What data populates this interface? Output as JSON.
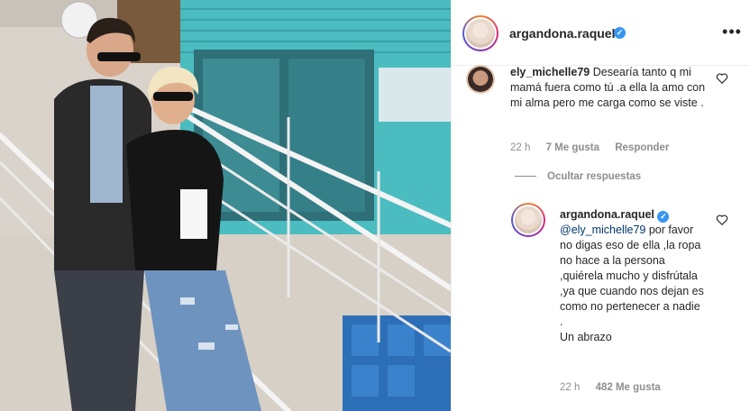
{
  "post": {
    "author": "argandona.raquel",
    "image_alt": "Pareja en escalera metálica frente a casa de madera turquesa"
  },
  "header": {
    "username": "argandona.raquel",
    "more_icon": "more-horizontal-icon"
  },
  "comments": [
    {
      "username": "ely_michelle79",
      "text": "Desearía tanto q mi mamá fuera como tú .a ella la amo con mi alma pero me carga como se viste .",
      "time": "22 h",
      "likes": "7 Me gusta",
      "reply_label": "Responder"
    }
  ],
  "replies_toggle": "Ocultar respuestas",
  "reply": {
    "username": "argandona.raquel",
    "mention": "@ely_michelle79",
    "text": " por favor no digas eso de ella ,la ropa no hace a la persona ,quiérela mucho y disfrútala ,ya que cuando nos dejan es como no pertenecer a nadie .",
    "signoff": "Un abrazo",
    "time": "22 h",
    "likes": "482 Me gusta"
  },
  "colors": {
    "verified": "#3897f0",
    "muted": "#8e8e8e",
    "mention": "#00376b"
  }
}
